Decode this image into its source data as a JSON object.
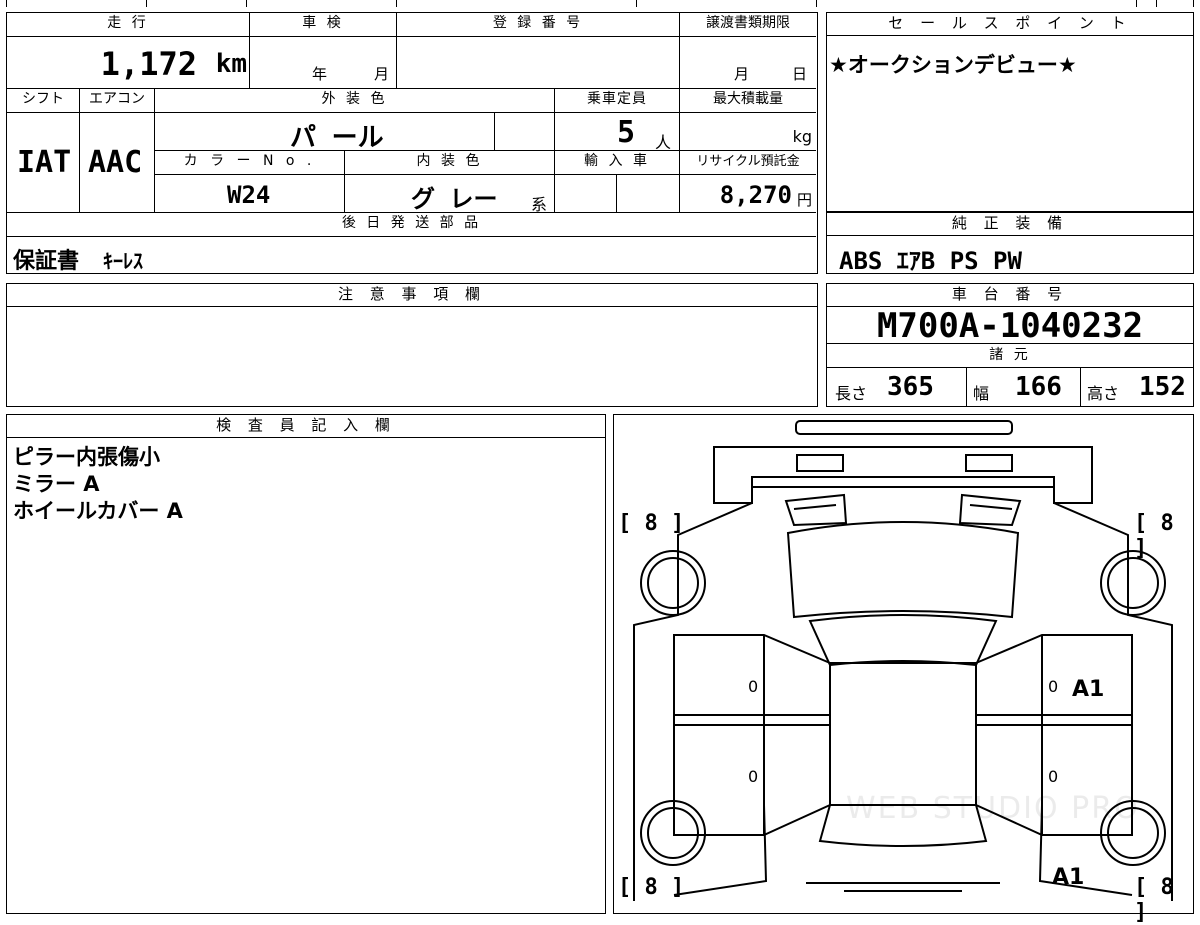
{
  "top_table": {
    "mileage_label": "走 行",
    "mileage_value": "1,172",
    "mileage_unit": "km",
    "shaken_label": "車 検",
    "shaken_year": "年",
    "shaken_month": "月",
    "reg_label": "登 録 番 号",
    "transfer_label": "譲渡書類期限",
    "transfer_month": "月",
    "transfer_day": "日",
    "shift_label": "シフト",
    "ac_label": "エアコン",
    "shift_value": "IAT",
    "ac_value": "AAC",
    "ext_color_label": "外 装 色",
    "ext_color_value": "パ ール",
    "capacity_label": "乗車定員",
    "capacity_value": "5",
    "capacity_unit": "人",
    "maxload_label": "最大積載量",
    "maxload_unit": "kg",
    "color_no_label": "カ ラ ー N o .",
    "color_no_value": "W24",
    "int_color_label": "内 装 色",
    "int_color_value": "グ レー",
    "int_color_suffix": "系",
    "import_label": "輸 入 車",
    "recycle_label": "リサイクル預託金",
    "recycle_value": "8,270",
    "recycle_unit": "円",
    "later_parts_label": "後 日 発 送 部 品",
    "later_parts_value_1": "保証書",
    "later_parts_value_2": "ｷｰﾚｽ"
  },
  "sales_point": {
    "label": "セ ー ル ス ポ イ ン ト",
    "value": "★オークションデビュー★"
  },
  "oem_equipment": {
    "label": "純 正 装 備",
    "value": "ABS ｴｱB PS PW"
  },
  "notes": {
    "label": "注 意 事 項 欄"
  },
  "chassis": {
    "label": "車 台 番 号",
    "value": "M700A-1040232",
    "specs_label": "諸 元",
    "length_label": "長さ",
    "length_value": "365",
    "width_label": "幅",
    "width_value": "166",
    "height_label": "高さ",
    "height_value": "152"
  },
  "inspector": {
    "label": "検 査 員 記 入 欄",
    "lines": [
      "ピラー内張傷小",
      "ミラー A",
      "ホイールカバー A"
    ]
  },
  "diagram": {
    "tire_fl": "[ 8 ]",
    "tire_fr": "[ 8 ]",
    "tire_rl": "[ 8 ]",
    "tire_rr": "[ 8 ]",
    "mark_front_right": "A1",
    "mark_rear_right": "A1",
    "zero_1": "0",
    "zero_2": "0",
    "zero_3": "0",
    "zero_4": "0",
    "watermark": "WEB STUDIO PRO"
  }
}
